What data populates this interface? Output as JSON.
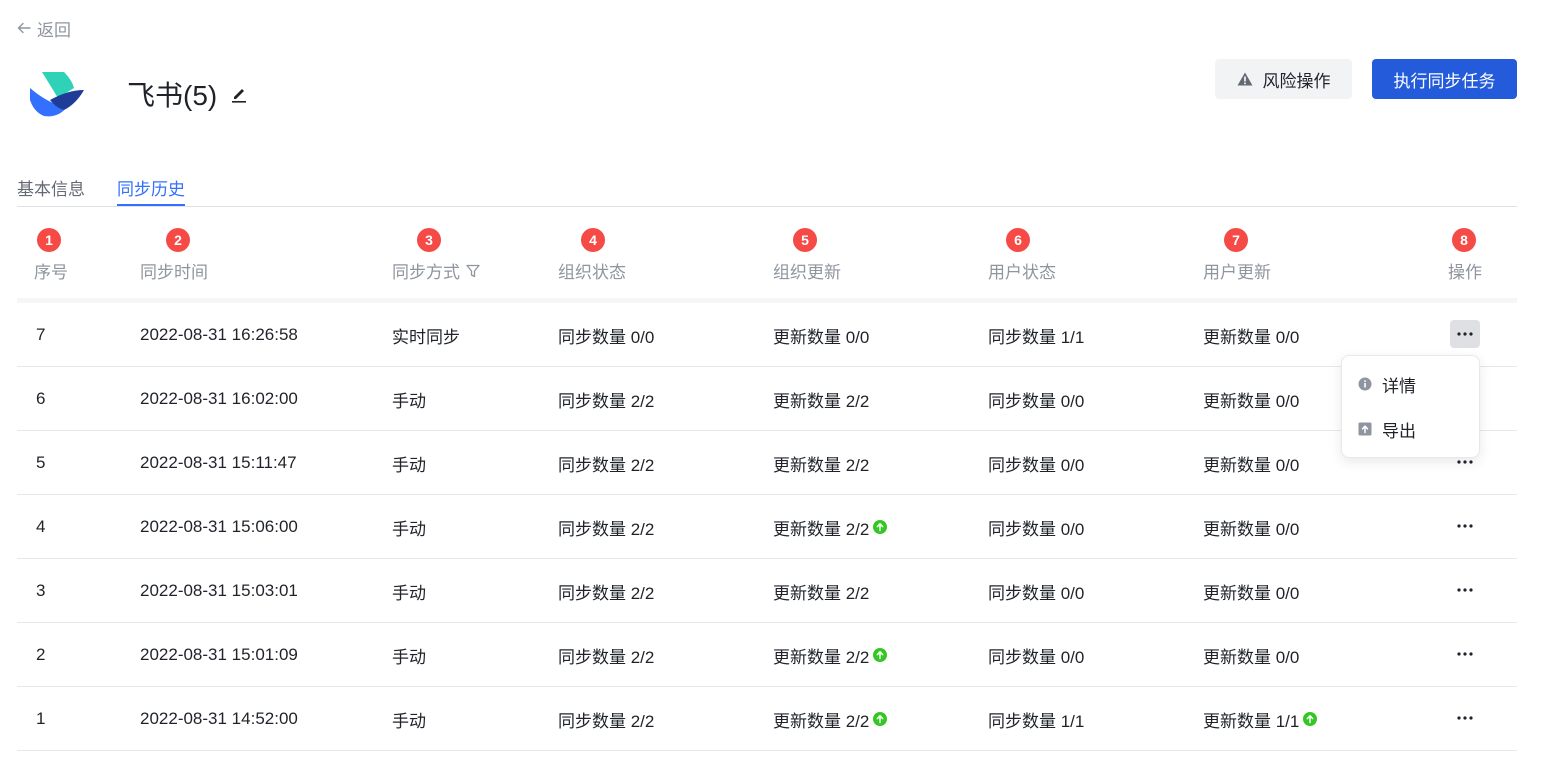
{
  "back": {
    "label": "返回"
  },
  "header": {
    "title": "飞书(5)",
    "risk_button": "风险操作",
    "sync_button": "执行同步任务"
  },
  "tabs": [
    {
      "label": "基本信息",
      "active": false
    },
    {
      "label": "同步历史",
      "active": true
    }
  ],
  "table": {
    "columns": [
      {
        "badge": "1",
        "label": "序号"
      },
      {
        "badge": "2",
        "label": "同步时间"
      },
      {
        "badge": "3",
        "label": "同步方式"
      },
      {
        "badge": "4",
        "label": "组织状态"
      },
      {
        "badge": "5",
        "label": "组织更新"
      },
      {
        "badge": "6",
        "label": "用户状态"
      },
      {
        "badge": "7",
        "label": "用户更新"
      },
      {
        "badge": "8",
        "label": "操作"
      }
    ],
    "rows": [
      {
        "index": "7",
        "time": "2022-08-31 16:26:58",
        "mode": "实时同步",
        "org_status": "同步数量 0/0",
        "org_update": "更新数量 0/0",
        "org_update_up": false,
        "user_status": "同步数量 1/1",
        "user_update": "更新数量 0/0",
        "user_update_up": false
      },
      {
        "index": "6",
        "time": "2022-08-31 16:02:00",
        "mode": "手动",
        "org_status": "同步数量 2/2",
        "org_update": "更新数量 2/2",
        "org_update_up": false,
        "user_status": "同步数量 0/0",
        "user_update": "更新数量 0/0",
        "user_update_up": false
      },
      {
        "index": "5",
        "time": "2022-08-31 15:11:47",
        "mode": "手动",
        "org_status": "同步数量 2/2",
        "org_update": "更新数量 2/2",
        "org_update_up": false,
        "user_status": "同步数量 0/0",
        "user_update": "更新数量 0/0",
        "user_update_up": false
      },
      {
        "index": "4",
        "time": "2022-08-31 15:06:00",
        "mode": "手动",
        "org_status": "同步数量 2/2",
        "org_update": "更新数量 2/2",
        "org_update_up": true,
        "user_status": "同步数量 0/0",
        "user_update": "更新数量 0/0",
        "user_update_up": false
      },
      {
        "index": "3",
        "time": "2022-08-31 15:03:01",
        "mode": "手动",
        "org_status": "同步数量 2/2",
        "org_update": "更新数量 2/2",
        "org_update_up": false,
        "user_status": "同步数量 0/0",
        "user_update": "更新数量 0/0",
        "user_update_up": false
      },
      {
        "index": "2",
        "time": "2022-08-31 15:01:09",
        "mode": "手动",
        "org_status": "同步数量 2/2",
        "org_update": "更新数量 2/2",
        "org_update_up": true,
        "user_status": "同步数量 0/0",
        "user_update": "更新数量 0/0",
        "user_update_up": false
      },
      {
        "index": "1",
        "time": "2022-08-31 14:52:00",
        "mode": "手动",
        "org_status": "同步数量 2/2",
        "org_update": "更新数量 2/2",
        "org_update_up": true,
        "user_status": "同步数量 1/1",
        "user_update": "更新数量 1/1",
        "user_update_up": true
      }
    ]
  },
  "menu": {
    "items": [
      {
        "label": "详情",
        "icon": "info-icon"
      },
      {
        "label": "导出",
        "icon": "export-icon"
      }
    ]
  },
  "colors": {
    "primary": "#245bdb",
    "tab_active": "#3370ff",
    "badge": "#f54a45",
    "up": "#34c724"
  }
}
